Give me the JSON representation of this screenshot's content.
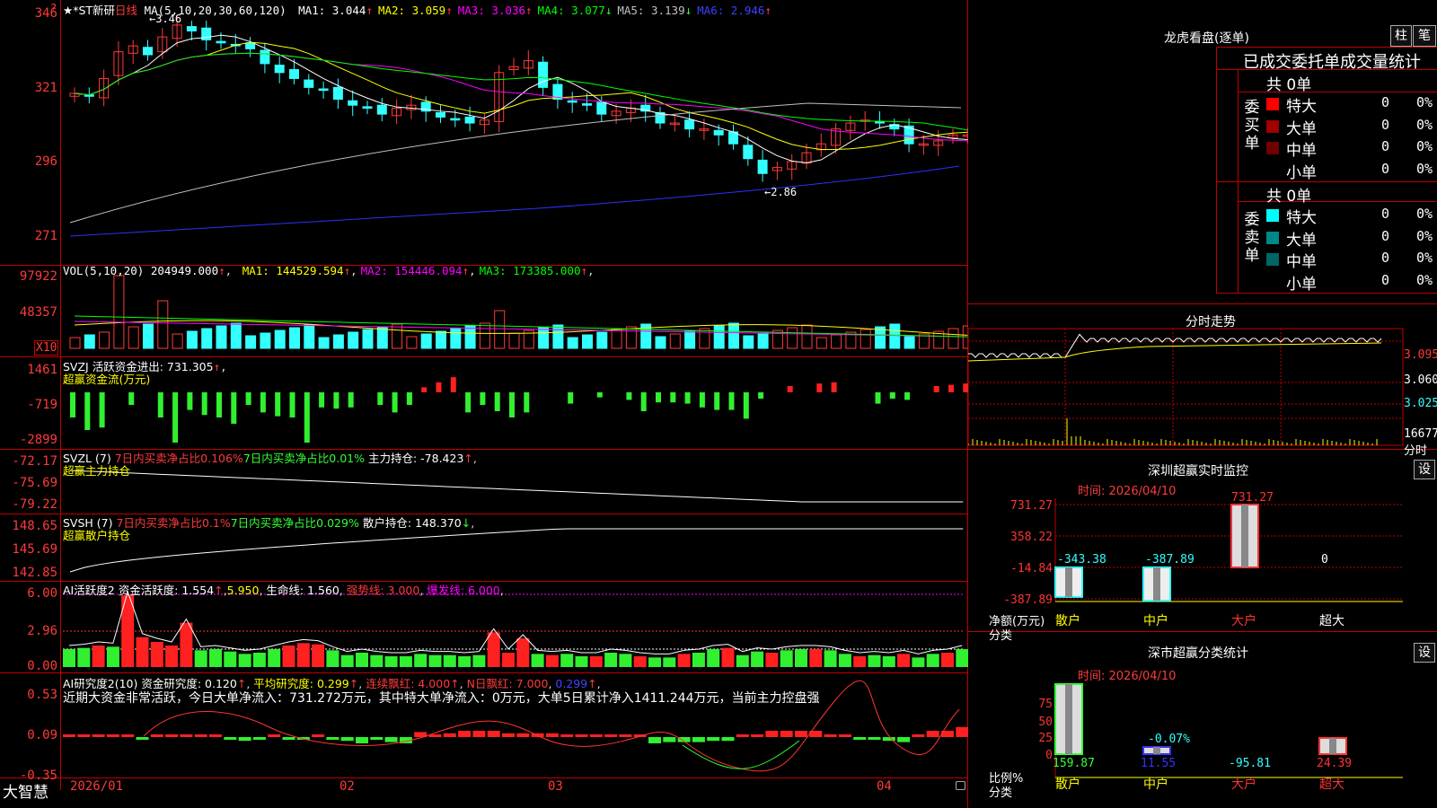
{
  "colors": {
    "up": "#ff3a3a",
    "down": "#33ffff",
    "grid": "#c00000",
    "ma1": "#ffffff",
    "ma2": "#ffff00",
    "ma3": "#ff00ff",
    "ma4": "#00ff00",
    "ma5": "#c0c0c0",
    "ma6": "#3030ff"
  },
  "kline": {
    "name": "★*ST新研",
    "period": "日线",
    "ma_title": "MA(5,10,20,30,60,120)",
    "ma_values": [
      {
        "label": "MA1: 3.044",
        "arrow": "↑",
        "color": "#ffffff"
      },
      {
        "label": "MA2: 3.059",
        "arrow": "↑",
        "color": "#ffff00"
      },
      {
        "label": "MA3: 3.036",
        "arrow": "↑",
        "color": "#ff00ff"
      },
      {
        "label": "MA4: 3.077",
        "arrow": "↓",
        "color": "#00ff00"
      },
      {
        "label": "MA5: 3.139",
        "arrow": "↓",
        "color": "#c0c0c0"
      },
      {
        "label": "MA6: 2.946",
        "arrow": "↑",
        "color": "#4040ff"
      }
    ],
    "y_ticks": [
      "346",
      "321",
      "296",
      "271"
    ],
    "high_mark": "3.46",
    "low_mark": "2.86",
    "question": "?"
  },
  "vol": {
    "title": "VOL(5,10,20)",
    "value": "204949.000",
    "ma": [
      {
        "label": "MA1: 144529.594",
        "color": "#ffff00"
      },
      {
        "label": "MA2: 154446.094",
        "color": "#ff00ff"
      },
      {
        "label": "MA3: 173385.000",
        "color": "#00ff00"
      }
    ],
    "y_ticks": [
      "97922",
      "48357"
    ],
    "unit": "X10"
  },
  "svzj": {
    "title": "SVZJ  活跃资金进出: 731.305",
    "subtitle": "超赢资金流(万元)",
    "y_ticks": [
      "1461",
      "-719",
      "-2899"
    ]
  },
  "svzl": {
    "title": "SVZL (7)",
    "p1": "7日内买卖净占比0.106%",
    "p2": "7日内买卖净占比0.01%",
    "p3": "主力持仓: -78.423",
    "subtitle": "超赢主力持仓",
    "y_ticks": [
      "-72.17",
      "-75.69",
      "-79.22"
    ]
  },
  "svsh": {
    "title": "SVSH (7)",
    "p1": "7日内买卖净占比0.1%",
    "p2": "7日内买卖净占比0.029%",
    "p3": "散户持仓: 148.370",
    "subtitle": "超赢散户持仓",
    "y_ticks": [
      "148.65",
      "145.69",
      "142.85"
    ]
  },
  "ai1": {
    "title": "AI活跃度2",
    "p1": "资金活跃度: 1.554",
    "p2": "5.950",
    "p3": "生命线: 1.560",
    "p4": "强势线: 3.000",
    "p5": "爆发线: 6.000",
    "y_ticks": [
      "6.00",
      "2.96",
      "0.00"
    ]
  },
  "ai2": {
    "title": "AI研究度2(10)",
    "p1": "资金研究度: 0.120",
    "p2": "平均研究度: 0.299",
    "p3": "连续飘红: 4.000",
    "p4": "N日飘红: 7.000",
    "p5": "0.299",
    "comment": "近期大资金非常活跃，今日大单净流入：731.272万元，其中特大单净流入：0万元，大单5日累计净入1411.244万元，当前主力控盘强",
    "y_ticks": [
      "0.53",
      "0.09",
      "-0.35"
    ]
  },
  "xaxis": {
    "brand": "大智慧",
    "dates": [
      "2026/01",
      "02",
      "03",
      "04"
    ]
  },
  "right": {
    "title": "龙虎看盘(逐单)",
    "btn_bar": "柱",
    "btn_pen": "笔",
    "stat_title": "已成交委托单成交量统计",
    "buy_label": "委买单",
    "sell_label": "委卖单",
    "buy_total": "共 0单",
    "sell_total": "共 0单",
    "buy_rows": [
      {
        "name": "特大",
        "count": "0",
        "pct": "0%",
        "color": "#ff0000"
      },
      {
        "name": "大单",
        "count": "0",
        "pct": "0%",
        "color": "#a00000"
      },
      {
        "name": "中单",
        "count": "0",
        "pct": "0%",
        "color": "#700000"
      },
      {
        "name": "小单",
        "count": "0",
        "pct": "0%",
        "color": ""
      }
    ],
    "sell_rows": [
      {
        "name": "特大",
        "count": "0",
        "pct": "0%",
        "color": "#00ffff"
      },
      {
        "name": "大单",
        "count": "0",
        "pct": "0%",
        "color": "#008888"
      },
      {
        "name": "中单",
        "count": "0",
        "pct": "0%",
        "color": "#006666"
      },
      {
        "name": "小单",
        "count": "0",
        "pct": "0%",
        "color": ""
      }
    ],
    "intraday": {
      "title": "分时走势",
      "y_ticks": [
        "3.095",
        "3.060",
        "3.025"
      ],
      "vol_tick": "16677",
      "vol_unit": "分时"
    },
    "sz_monitor": {
      "title": "深圳超赢实时监控",
      "set": "设",
      "time": "时间: 2026/04/10",
      "y_ticks": [
        "731.27",
        "358.22",
        "-14.84",
        "-387.89"
      ],
      "ylabel": "净额(万元)",
      "xlabel": "分类",
      "categories": [
        "散户",
        "中户",
        "大户",
        "超大"
      ],
      "values": [
        -343.38,
        -387.89,
        731.27,
        0
      ],
      "value_labels": [
        "-343.38",
        "-387.89",
        "731.27",
        "0"
      ]
    },
    "sz_class": {
      "title": "深市超赢分类统计",
      "set": "设",
      "time": "时间: 2026/04/10",
      "y_ticks": [
        "75",
        "50",
        "25",
        "0"
      ],
      "ylabel": "比例%",
      "xlabel": "分类",
      "categories": [
        "散户",
        "中户",
        "大户",
        "超大"
      ],
      "values": [
        159.87,
        11.55,
        -95.81,
        24.39
      ],
      "value_labels": [
        "159.87",
        "11.55",
        "-95.81",
        "24.39"
      ],
      "extra_label": "-0.07%"
    }
  },
  "chart_data": {
    "type": "table",
    "title": "",
    "candles_close_approx": [
      3.2,
      3.19,
      3.25,
      3.34,
      3.36,
      3.33,
      3.39,
      3.43,
      3.41,
      3.38,
      3.37,
      3.36,
      3.35,
      3.3,
      3.27,
      3.25,
      3.22,
      3.21,
      3.18,
      3.16,
      3.15,
      3.13,
      3.15,
      3.16,
      3.14,
      3.12,
      3.11,
      3.1,
      3.11,
      3.27,
      3.29,
      3.31,
      3.22,
      3.18,
      3.17,
      3.16,
      3.13,
      3.14,
      3.15,
      3.14,
      3.1,
      3.1,
      3.08,
      3.08,
      3.06,
      3.03,
      2.98,
      2.93,
      2.95,
      2.97,
      3.0,
      3.03,
      3.08,
      3.1,
      3.11,
      3.1,
      3.08,
      3.03,
      3.03,
      3.04,
      3.06,
      3.06
    ]
  }
}
